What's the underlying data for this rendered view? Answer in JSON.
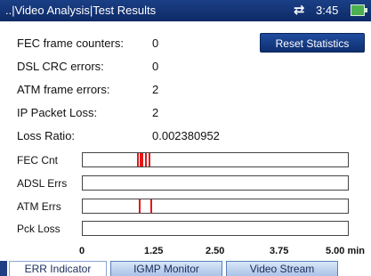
{
  "titlebar": {
    "title": "..|Video Analysis|Test Results",
    "arrows_icon": "⇄",
    "time": "3:45",
    "battery_icon": "battery-icon"
  },
  "stats": [
    {
      "label": "FEC frame counters:",
      "value": "0"
    },
    {
      "label": "DSL CRC errors:",
      "value": "0"
    },
    {
      "label": "ATM frame errors:",
      "value": "2"
    },
    {
      "label": "IP Packet Loss:",
      "value": "2"
    },
    {
      "label": "Loss Ratio:",
      "value": "0.002380952"
    }
  ],
  "reset_label": "Reset Statistics",
  "chart_data": {
    "type": "timeline",
    "xlim": [
      0,
      5
    ],
    "unit": "min",
    "ticks": [
      "0",
      "1.25",
      "2.50",
      "3.75",
      "5.00 min"
    ],
    "rows": [
      {
        "label": "FEC Cnt",
        "events": [
          1.03,
          1.07,
          1.11,
          1.18,
          1.24
        ]
      },
      {
        "label": "ADSL Errs",
        "events": []
      },
      {
        "label": "ATM Errs",
        "events": [
          1.05,
          1.27
        ]
      },
      {
        "label": "Pck Loss",
        "events": []
      }
    ],
    "colors": {
      "event": "#e21818"
    }
  },
  "tabs": [
    {
      "label": "ERR Indicator",
      "active": true
    },
    {
      "label": "IGMP Monitor",
      "active": false
    },
    {
      "label": "Video Stream",
      "active": false
    }
  ]
}
